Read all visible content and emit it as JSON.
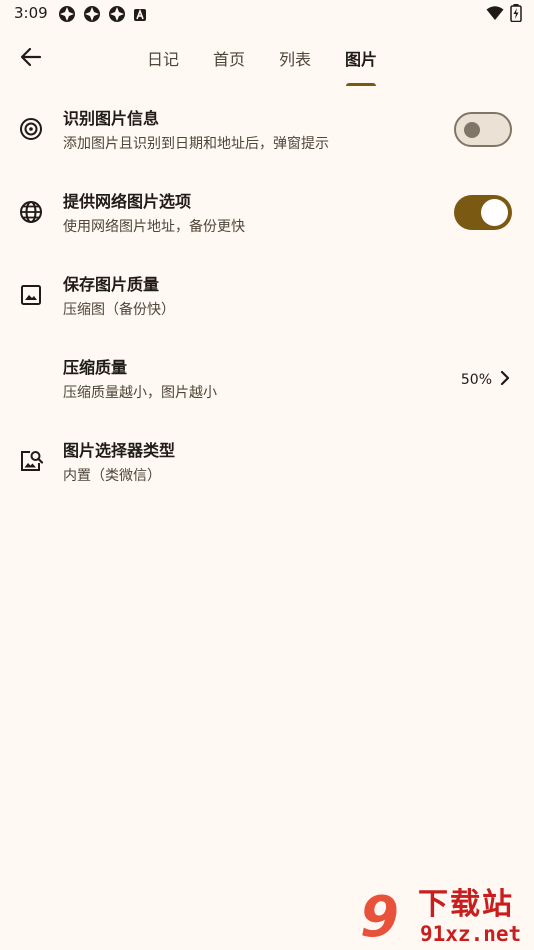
{
  "status_bar": {
    "time": "3:09",
    "left_icons": [
      "app-notification-icon",
      "app-notification-icon",
      "app-notification-icon",
      "a-badge-icon"
    ],
    "right_icons": [
      "wifi-icon",
      "battery-icon"
    ]
  },
  "app_bar": {
    "back_icon": "arrow-left-icon",
    "tabs": [
      {
        "label": "日记",
        "active": false
      },
      {
        "label": "首页",
        "active": false
      },
      {
        "label": "列表",
        "active": false
      },
      {
        "label": "图片",
        "active": true
      }
    ]
  },
  "settings": [
    {
      "icon": "target-icon",
      "title": "识别图片信息",
      "subtitle": "添加图片且识别到日期和地址后，弹窗提示",
      "control": "switch",
      "checked": false
    },
    {
      "icon": "globe-icon",
      "title": "提供网络图片选项",
      "subtitle": "使用网络图片地址，备份更快",
      "control": "switch",
      "checked": true
    },
    {
      "icon": "image-icon",
      "title": "保存图片质量",
      "subtitle": "压缩图（备份快）",
      "control": "none"
    },
    {
      "icon": "",
      "title": "压缩质量",
      "subtitle": "压缩质量越小，图片越小",
      "control": "value",
      "value": "50%"
    },
    {
      "icon": "image-search-icon",
      "title": "图片选择器类型",
      "subtitle": "内置（类微信）",
      "control": "none"
    }
  ],
  "watermark": {
    "mark": "9",
    "title": "下载站",
    "url": "91xz.net"
  },
  "colors": {
    "background": "#fff8f3",
    "accent": "#7a5a12",
    "watermark": "#c81e1e"
  }
}
